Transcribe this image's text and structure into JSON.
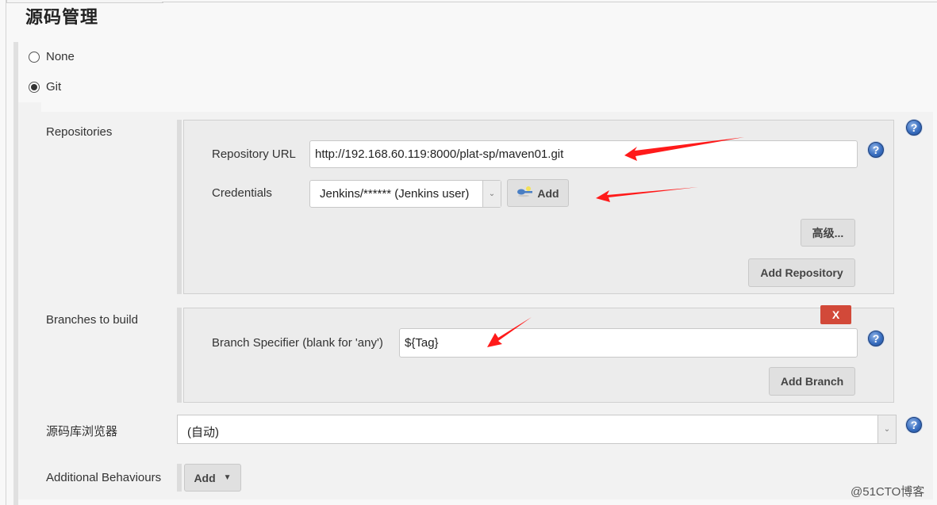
{
  "section": {
    "title": "源码管理"
  },
  "scm_options": [
    {
      "label": "None",
      "selected": false
    },
    {
      "label": "Git",
      "selected": true
    }
  ],
  "git": {
    "repositories_label": "Repositories",
    "repository_url_label": "Repository URL",
    "repository_url_value": "http://192.168.60.119:8000/plat-sp/maven01.git",
    "credentials_label": "Credentials",
    "credentials_value": "Jenkins/****** (Jenkins user)",
    "credentials_add_label": "Add",
    "advanced_label": "高级...",
    "add_repository_label": "Add Repository",
    "branches_label": "Branches to build",
    "branch_specifier_label": "Branch Specifier (blank for 'any')",
    "branch_specifier_value": "${Tag}",
    "delete_branch_label": "X",
    "add_branch_label": "Add Branch",
    "browser_label": "源码库浏览器",
    "browser_value": "(自动)",
    "additional_behaviours_label": "Additional Behaviours",
    "additional_add_label": "Add"
  },
  "help_icon_glyph": "?",
  "watermark": "@51CTO博客",
  "colors": {
    "annotation_arrow": "#ff1a1a",
    "delete_button": "#d24939",
    "help_icon": "#3a6fc0"
  }
}
